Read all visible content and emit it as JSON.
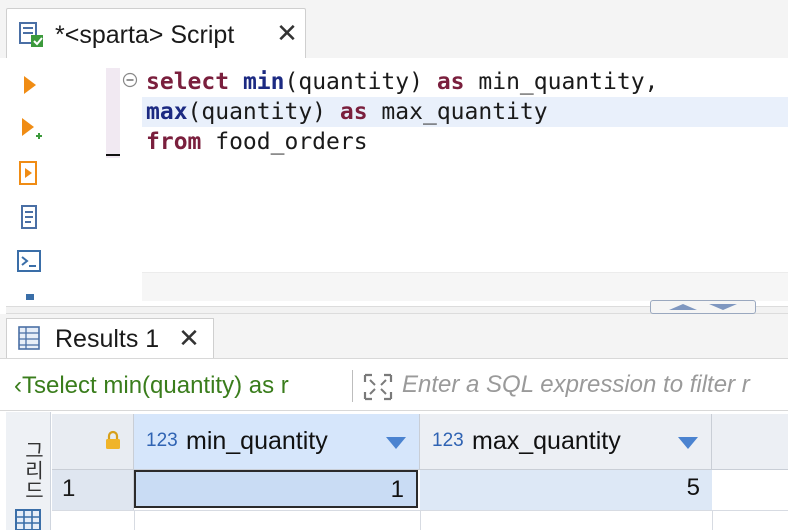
{
  "editor_tab": {
    "title": "*<sparta> Script",
    "icon": "sql-script-icon",
    "close": "✕"
  },
  "editor_toolbar": [
    {
      "name": "execute-statement-icon"
    },
    {
      "name": "execute-new-tab-icon"
    },
    {
      "name": "execute-script-icon"
    },
    {
      "name": "explain-plan-icon"
    },
    {
      "name": "open-console-icon"
    }
  ],
  "code": {
    "line1": {
      "kw1": "select",
      "fn1": "min",
      "rest1": "(quantity) ",
      "kw2": "as",
      "rest2": " min_quantity,"
    },
    "line2": {
      "fn1": "max",
      "rest1": "(quantity) ",
      "kw1": "as",
      "rest2": " max_quantity"
    },
    "line3": {
      "kw1": "from",
      "rest1": " food_orders"
    }
  },
  "results_tab": {
    "title": "Results 1",
    "icon": "grid-table-icon",
    "close": "✕"
  },
  "filter": {
    "query_prefix": "‹T",
    "query_text": "select min(quantity) as r",
    "placeholder": "Enter a SQL expression to filter r"
  },
  "grid": {
    "side_label": "그리드",
    "columns": [
      {
        "type": "123",
        "name": "min_quantity"
      },
      {
        "type": "123",
        "name": "max_quantity"
      }
    ],
    "rows": [
      {
        "num": "1",
        "values": [
          "1",
          "5"
        ]
      }
    ]
  },
  "colors": {
    "keyword": "#7a1f3d",
    "function": "#1c2a82",
    "filter_text": "#3a7d1c",
    "selected_header": "#d6e6fb",
    "selected_cell": "#c9dcf4",
    "type_badge": "#2f63b3"
  }
}
